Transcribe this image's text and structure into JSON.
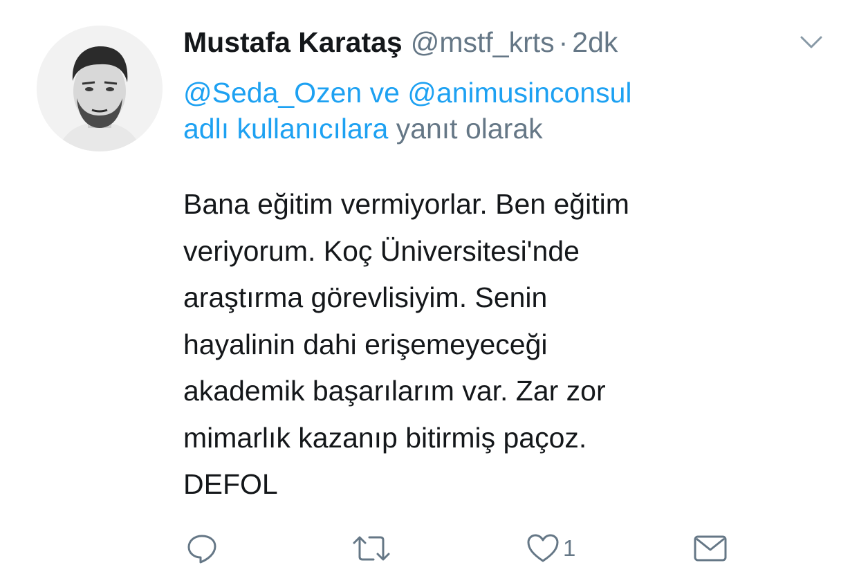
{
  "tweet": {
    "display_name": "Mustafa Karataş",
    "handle": "@mstf_krts",
    "separator": "·",
    "time": "2dk",
    "reply_context": {
      "mention_1": "@Seda_Ozen",
      "conjunction": "ve",
      "mention_2": "@animusinconsul",
      "users_text": "adlı kullanıcılara",
      "suffix": "yanıt olarak"
    },
    "body_lines": [
      "Bana eğitim vermiyorlar. Ben eğitim",
      "veriyorum. Koç Üniversitesi'nde",
      "araştırma görevlisiyim. Senin",
      "hayalinin dahi erişemeyeceği",
      "akademik başarılarım var. Zar zor",
      "mimarlık kazanıp bitirmiş paçoz.",
      "DEFOL"
    ],
    "actions": {
      "reply_icon": "reply-icon",
      "retweet_icon": "retweet-icon",
      "like_icon": "heart-icon",
      "like_count": "1",
      "dm_icon": "envelope-icon"
    }
  },
  "colors": {
    "text": "#14171a",
    "secondary": "#657786",
    "link": "#1da1f2",
    "background": "#ffffff"
  }
}
